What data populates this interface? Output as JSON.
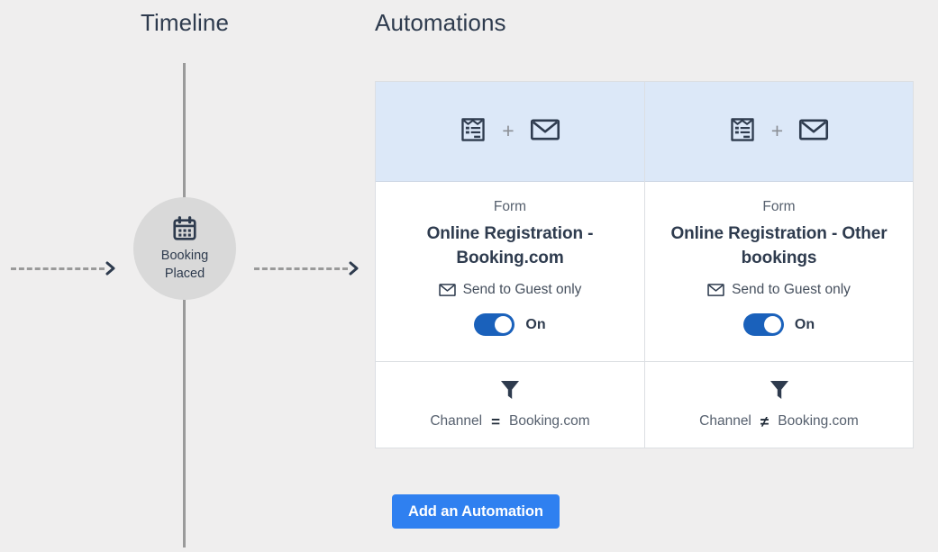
{
  "columns": {
    "timeline_title": "Timeline",
    "automations_title": "Automations"
  },
  "timeline": {
    "node": {
      "icon": "calendar-icon",
      "label": "Booking\nPlaced",
      "label_line1": "Booking",
      "label_line2": "Placed"
    },
    "connector_in": "dashed-arrow-right",
    "connector_out": "dashed-arrow-right"
  },
  "automations": {
    "cards": [
      {
        "header_icons": [
          "form-icon",
          "envelope-icon"
        ],
        "plus": "+",
        "kind": "Form",
        "name": "Online Registration - Booking.com",
        "recipient_icon": "envelope-icon",
        "recipient": "Send to Guest only",
        "toggle_state": "On",
        "toggle_on": true,
        "filter_icon": "funnel-icon",
        "filter_field": "Channel",
        "filter_operator": "=",
        "filter_value": "Booking.com"
      },
      {
        "header_icons": [
          "form-icon",
          "envelope-icon"
        ],
        "plus": "+",
        "kind": "Form",
        "name": "Online Registration - Other bookings",
        "recipient_icon": "envelope-icon",
        "recipient": "Send to Guest only",
        "toggle_state": "On",
        "toggle_on": true,
        "filter_icon": "funnel-icon",
        "filter_field": "Channel",
        "filter_operator": "≠",
        "filter_value": "Booking.com"
      }
    ],
    "add_button_label": "Add an Automation"
  },
  "colors": {
    "background": "#efeeee",
    "card_header": "#dce8f8",
    "text_dark": "#2e3b4e",
    "text_muted": "#56606e",
    "toggle_on": "#1a61bb",
    "primary_button": "#2f80f0",
    "timeline_line": "#9a9a9a",
    "timeline_node": "#d9d9d9",
    "border": "#dcdfe3"
  }
}
